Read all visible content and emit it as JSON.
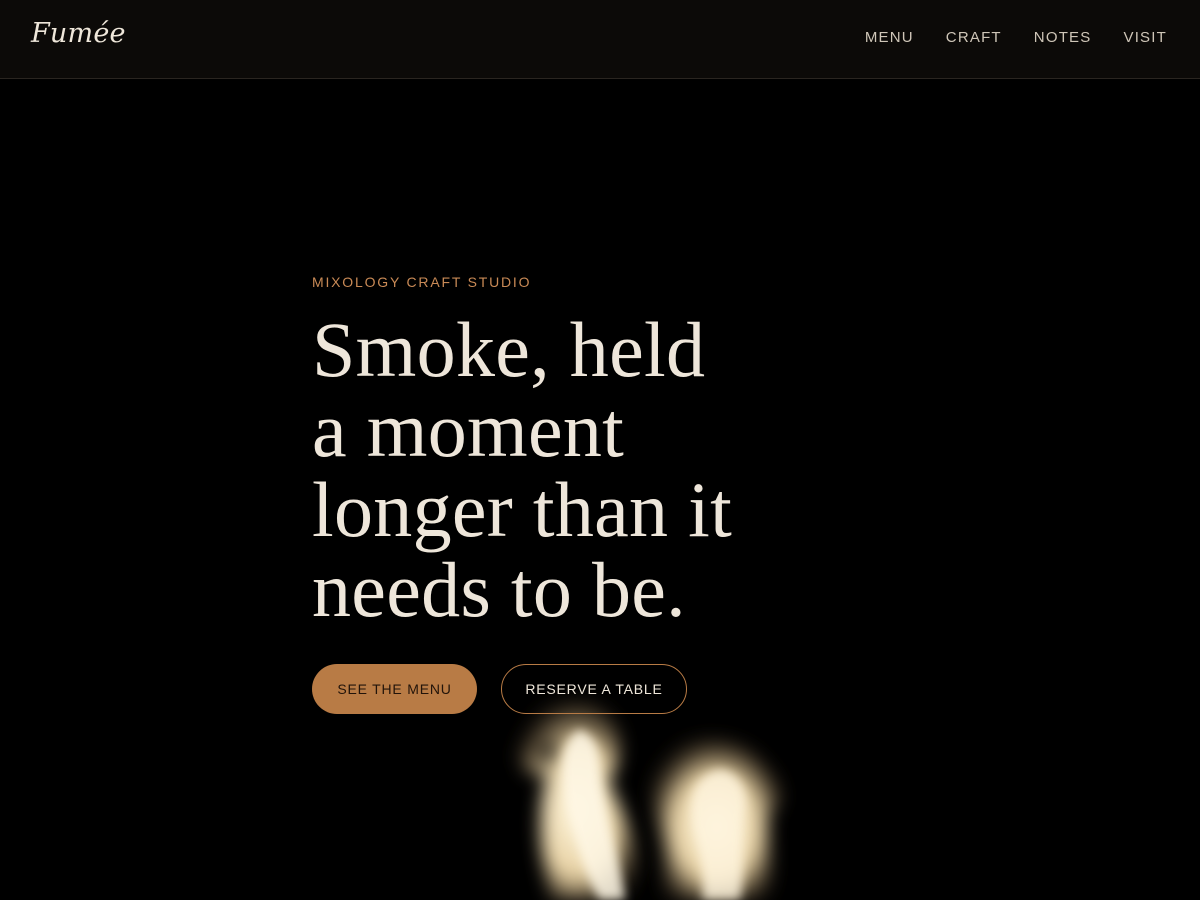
{
  "header": {
    "logo": "Fumée",
    "nav": [
      "MENU",
      "CRAFT",
      "NOTES",
      "VISIT"
    ]
  },
  "hero": {
    "eyebrow": "MIXOLOGY CRAFT STUDIO",
    "title_lines": [
      "Smoke, held",
      "a moment",
      "longer than it",
      "needs to be."
    ],
    "primary_button": "SEE THE MENU",
    "secondary_button": "RESERVE A TABLE"
  },
  "colors": {
    "background": "#000000",
    "header_bg": "#0c0a08",
    "accent": "#b87b45",
    "eyebrow": "#c98a56",
    "text_light": "#eee6da",
    "nav_text": "#cfc6b8"
  },
  "decor": {
    "smoke_image": "smoke-flame-illustration"
  }
}
